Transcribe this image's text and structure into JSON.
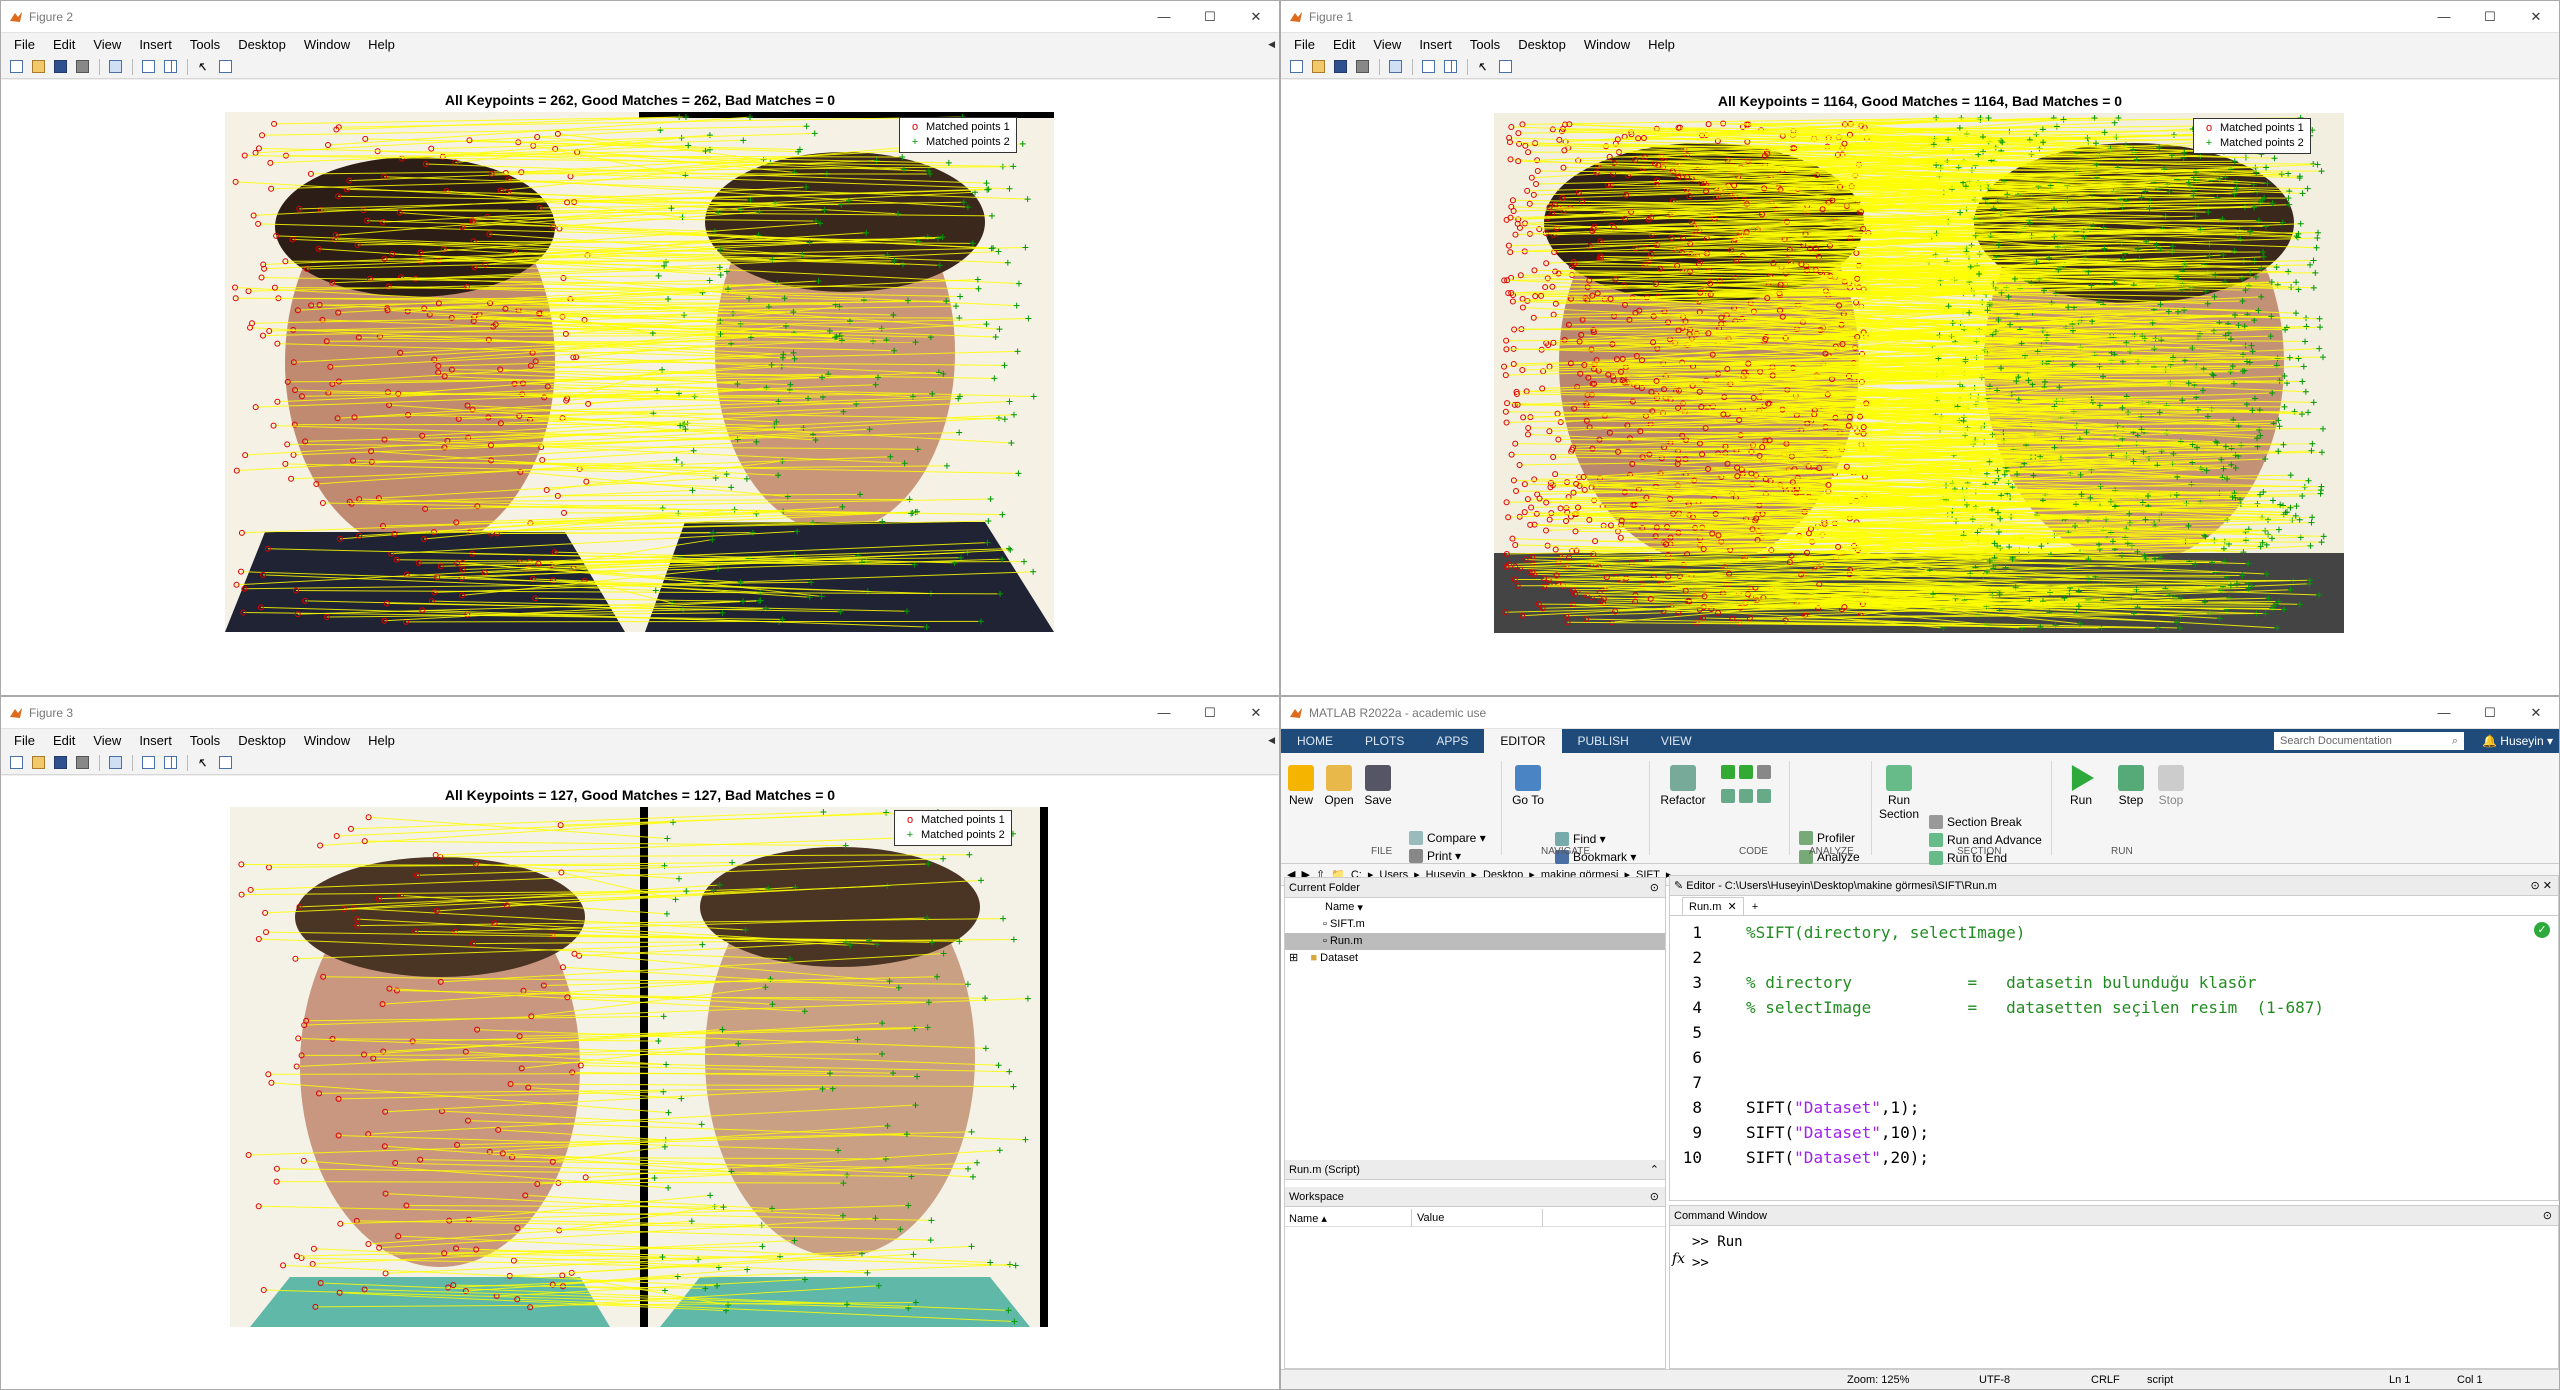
{
  "figures": [
    {
      "id": "fig2",
      "title": "Figure 2",
      "plot_title": "All Keypoints = 262, Good Matches = 262, Bad Matches = 0"
    },
    {
      "id": "fig1",
      "title": "Figure 1",
      "plot_title": "All Keypoints = 1164, Good Matches = 1164, Bad Matches = 0"
    },
    {
      "id": "fig3",
      "title": "Figure 3",
      "plot_title": "All Keypoints = 127, Good Matches = 127, Bad Matches = 0"
    }
  ],
  "figure_menu": [
    "File",
    "Edit",
    "View",
    "Insert",
    "Tools",
    "Desktop",
    "Window",
    "Help"
  ],
  "legend": {
    "entry1": "Matched points 1",
    "entry2": "Matched points 2",
    "marker1": "o",
    "marker2": "+",
    "color1": "#dd0000",
    "color2": "#009900"
  },
  "match_line_color": "#ffff00",
  "matlab": {
    "title": "MATLAB R2022a - academic use",
    "tabs": [
      "HOME",
      "PLOTS",
      "APPS",
      "EDITOR",
      "PUBLISH",
      "VIEW"
    ],
    "active_tab": "EDITOR",
    "search_placeholder": "Search Documentation",
    "user": "Huseyin",
    "ribbon": {
      "new": "New",
      "open": "Open",
      "save": "Save",
      "compare": "Compare",
      "print": "Print",
      "goto": "Go To",
      "find": "Find",
      "bookmark": "Bookmark",
      "refactor": "Refactor",
      "profiler": "Profiler",
      "analyze": "Analyze",
      "run_section": "Run\nSection",
      "section_break": "Section Break",
      "run_advance": "Run and Advance",
      "run_to_end": "Run to End",
      "run": "Run",
      "step": "Step",
      "stop": "Stop",
      "groups": [
        "FILE",
        "NAVIGATE",
        "CODE",
        "ANALYZE",
        "SECTION",
        "RUN"
      ]
    },
    "path": [
      "C:",
      "Users",
      "Huseyin",
      "Desktop",
      "makine görmesi",
      "SIFT"
    ],
    "current_folder": {
      "header": "Current Folder",
      "col_name": "Name",
      "items": [
        "SIFT.m",
        "Run.m",
        "Dataset"
      ],
      "selected": "Run.m"
    },
    "details": "Run.m  (Script)",
    "workspace": {
      "header": "Workspace",
      "col_name": "Name",
      "col_value": "Value"
    },
    "editor": {
      "header": "Editor - C:\\Users\\Huseyin\\Desktop\\makine görmesi\\SIFT\\Run.m",
      "tab": "Run.m",
      "lines": [
        {
          "n": "1",
          "text": "%SIFT(directory, selectImage)",
          "kind": "comment"
        },
        {
          "n": "2",
          "text": "",
          "kind": "plain"
        },
        {
          "n": "3",
          "text": "% directory            =   datasetin bulunduğu klasör",
          "kind": "comment"
        },
        {
          "n": "4",
          "text": "% selectImage          =   datasetten seçilen resim  (1-687)",
          "kind": "comment"
        },
        {
          "n": "5",
          "text": "",
          "kind": "plain"
        },
        {
          "n": "6",
          "text": "",
          "kind": "plain"
        },
        {
          "n": "7",
          "text": "",
          "kind": "plain"
        },
        {
          "n": "8",
          "pre": "SIFT(",
          "str": "\"Dataset\"",
          "post": ",1);",
          "kind": "call"
        },
        {
          "n": "9",
          "pre": "SIFT(",
          "str": "\"Dataset\"",
          "post": ",10);",
          "kind": "call"
        },
        {
          "n": "10",
          "pre": "SIFT(",
          "str": "\"Dataset\"",
          "post": ",20);",
          "kind": "call"
        }
      ]
    },
    "command_window": {
      "header": "Command Window",
      "line1": ">> Run",
      "line2": ">>",
      "fx": "fx"
    },
    "status": {
      "zoom": "Zoom: 125%",
      "encoding": "UTF-8",
      "eol": "CRLF",
      "type": "script",
      "ln": "Ln  1",
      "col": "Col  1"
    }
  }
}
